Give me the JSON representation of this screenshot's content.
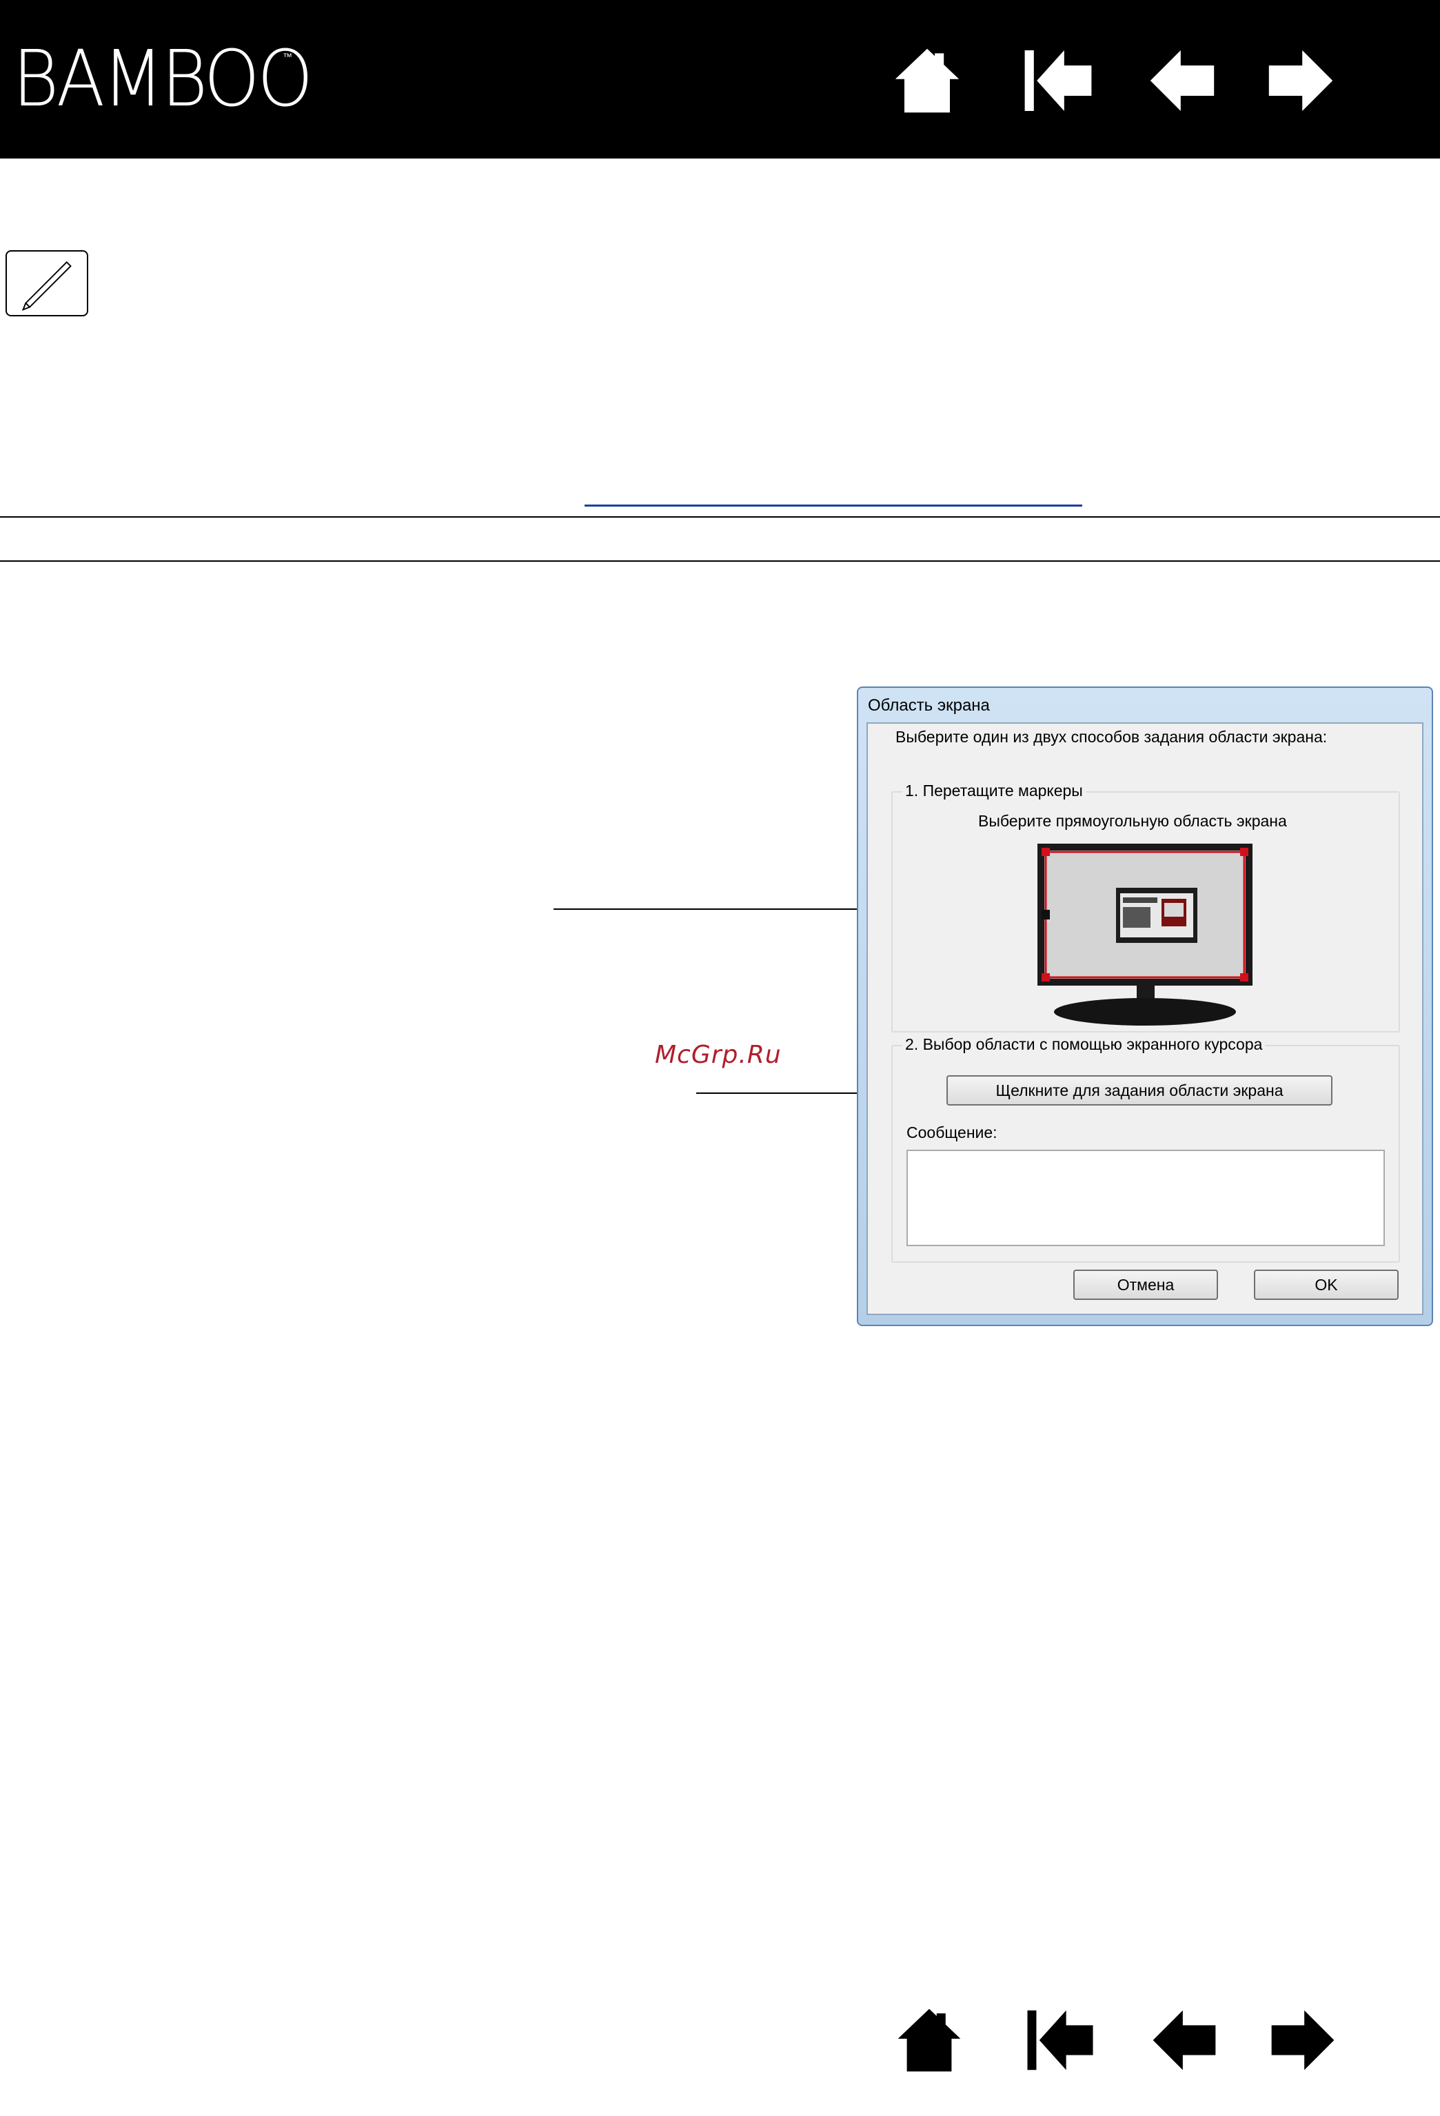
{
  "header": {
    "logo_text": "BAMBOO",
    "logo_trademark": "™",
    "background": "#000000",
    "nav_icons": [
      "home-icon",
      "first-page-icon",
      "previous-page-icon",
      "next-page-icon"
    ]
  },
  "page": {
    "pen_icon": "pen-icon",
    "watermark": "McGrp.Ru",
    "link_color": "#1a3fa8"
  },
  "dialog": {
    "title": "Область экрана",
    "instruction": "Выберите один из двух способов задания области экрана:",
    "group1": {
      "label": "1. Перетащите маркеры",
      "subtitle": "Выберите прямоугольную область экрана",
      "marker_color": "#d0101c"
    },
    "group2": {
      "label": "2. Выбор области с помощью экранного курсора",
      "button_label": "Щелкните для задания области экрана"
    },
    "message_label": "Сообщение:",
    "message_value": "",
    "cancel_label": "Отмена",
    "ok_label": "OK"
  },
  "footer": {
    "nav_icons": [
      "home-icon",
      "first-page-icon",
      "previous-page-icon",
      "next-page-icon"
    ]
  }
}
